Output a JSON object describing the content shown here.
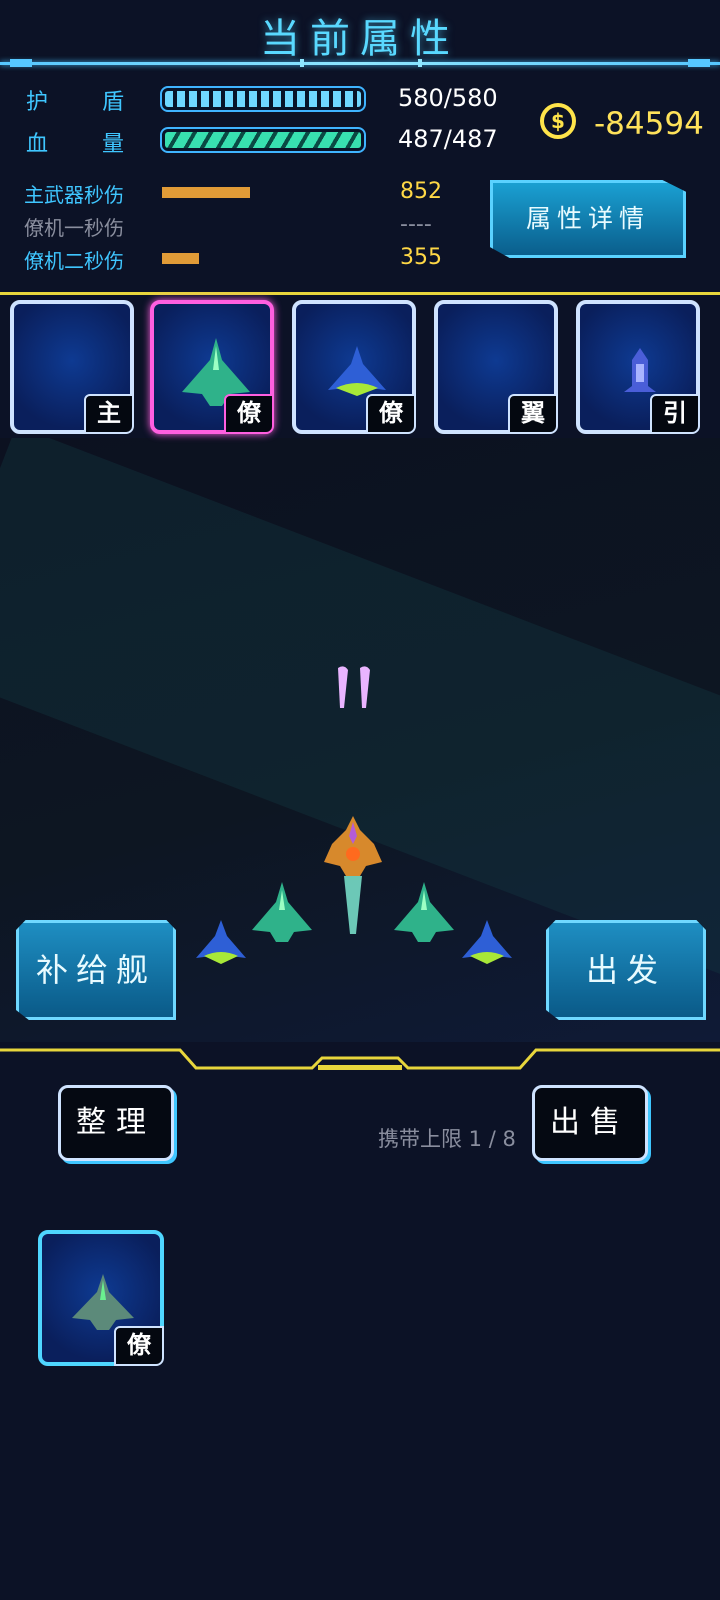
{
  "header": {
    "title": "当前属性"
  },
  "stats": {
    "shield": {
      "label_a": "护",
      "label_b": "盾",
      "value": "580/580",
      "fill": 1.0
    },
    "hp": {
      "label_a": "血",
      "label_b": "量",
      "value": "487/487",
      "fill": 1.0
    }
  },
  "currency": {
    "amount": "-84594",
    "icon": "coin-icon",
    "color": "#ffe44a"
  },
  "dps": [
    {
      "label": "主武器秒伤",
      "value": "852",
      "fill": 0.55,
      "color": "#3fc6ff"
    },
    {
      "label": "僚机一秒伤",
      "value": "----",
      "fill": 0,
      "color": "#8a8e9e"
    },
    {
      "label": "僚机二秒伤",
      "value": "355",
      "fill": 0.23,
      "color": "#3fc6ff"
    }
  ],
  "detail_button": "属性详情",
  "slots": [
    {
      "tag": "主",
      "item": "",
      "selected": false
    },
    {
      "tag": "僚",
      "item": "green-wingman-ship-icon",
      "selected": true
    },
    {
      "tag": "僚",
      "item": "blue-wingman-ship-icon",
      "selected": false
    },
    {
      "tag": "翼",
      "item": "",
      "selected": false
    },
    {
      "tag": "引",
      "item": "engine-icon",
      "selected": false
    }
  ],
  "actions": {
    "supply_ship": "补给舰",
    "depart": "出发",
    "organize": "整理",
    "sell": "出售"
  },
  "inventory": {
    "capacity_text": "携带上限 1 / 8",
    "items": [
      {
        "tag": "僚",
        "item": "green-wingman-ship-icon"
      }
    ]
  },
  "colors": {
    "accent": "#3fc6ff",
    "gold": "#ffd846",
    "selected": "#ff5fe0",
    "yellow_line": "#e8d63c"
  }
}
